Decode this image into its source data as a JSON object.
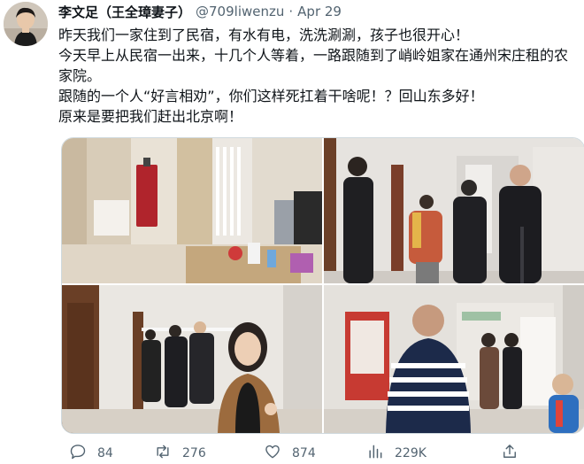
{
  "tweet": {
    "author": {
      "display_name": "李文足（王全璋妻子）",
      "handle": "@709liwenzu",
      "separator": "·",
      "date": "Apr 29"
    },
    "lines": [
      "昨天我们一家住到了民宿，有水有电，洗洗涮涮，孩子也很开心！",
      "今天早上从民宿一出来，十几个人等着，一路跟随到了峭岭姐家在通州宋庄租的农家院。",
      "跟随的一个人“好言相劝”，你们这样死扛着干啥呢！？回山东多好！",
      "原来是要把我们赶出北京啊！"
    ],
    "media": [
      {
        "name": "photo-room-interior"
      },
      {
        "name": "photo-hallway-men"
      },
      {
        "name": "photo-corridor-smiling-woman"
      },
      {
        "name": "photo-lobby-crowd"
      }
    ],
    "stats": {
      "replies": "84",
      "retweets": "276",
      "likes": "874",
      "views": "229K"
    },
    "icons": {
      "reply": "reply-icon",
      "retweet": "retweet-icon",
      "like": "heart-icon",
      "views": "views-chart-icon",
      "share": "share-icon"
    },
    "colors": {
      "text": "#0f1419",
      "secondary": "#536471",
      "border": "#cfd9de"
    }
  }
}
